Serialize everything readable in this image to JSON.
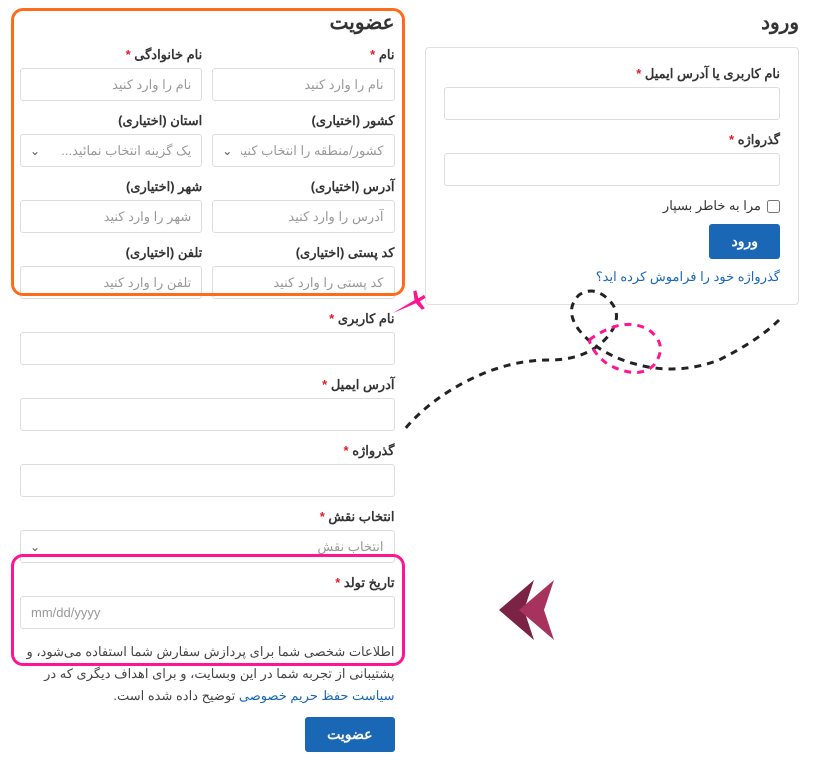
{
  "login": {
    "title": "ورود",
    "username_label": "نام کاربری یا آدرس ایمیل",
    "password_label": "گذرواژه",
    "remember_label": "مرا به خاطر بسپار",
    "button": "ورود",
    "forgot": "گذرواژه خود را فراموش کرده اید؟"
  },
  "register": {
    "title": "عضویت",
    "first_name_label": "نام",
    "first_name_ph": "نام را وارد کنید",
    "last_name_label": "نام خانوادگی",
    "last_name_ph": "نام را وارد کنید",
    "country_label": "کشور (اختیاری)",
    "country_ph": "کشور/منطقه را انتخاب کنید...",
    "state_label": "استان (اختیاری)",
    "state_ph": "یک گزینه انتخاب نمائید...",
    "address_label": "آدرس (اختیاری)",
    "address_ph": "آدرس را وارد کنید",
    "city_label": "شهر (اختیاری)",
    "city_ph": "شهر را وارد کنید",
    "postal_label": "کد پستی (اختیاری)",
    "postal_ph": "کد پستی را وارد کنید",
    "phone_label": "تلفن (اختیاری)",
    "phone_ph": "تلفن را وارد کنید",
    "username_label": "نام کاربری",
    "email_label": "آدرس ایمیل",
    "password_label": "گذرواژه",
    "role_label": "انتخاب نقش",
    "role_ph": "انتخاب نقش",
    "dob_label": "تاریخ تولد",
    "dob_ph": "mm/dd/yyyy",
    "privacy_1": "اطلاعات شخصی شما برای پردازش سفارش شما استفاده می‌شود، و پشتیبانی از تجربه شما در این وبسایت، و برای اهداف دیگری که در ",
    "privacy_link": "سیاست حفظ حریم خصوصی",
    "privacy_2": " توضیح داده شده است.",
    "button": "عضویت"
  }
}
